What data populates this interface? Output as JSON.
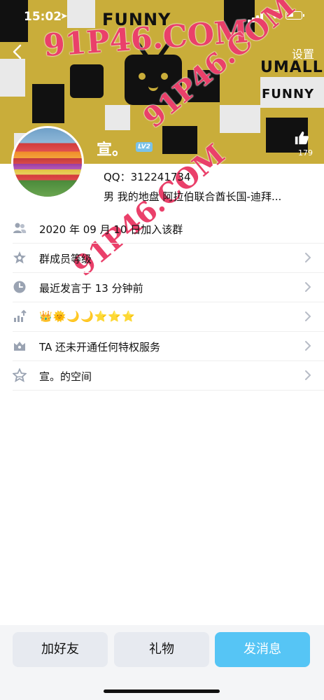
{
  "status_bar": {
    "time": "15:02"
  },
  "header": {
    "settings_label": "设置",
    "like_count": "179",
    "banner_words": [
      "FUNNY",
      "UMALL",
      "FUNNY"
    ]
  },
  "watermarks": [
    "91P46.COM",
    "91P46.COM",
    "91P46.COM"
  ],
  "profile": {
    "name": "宣。",
    "level_badge": "LV2",
    "qq_line": "QQ：312241734",
    "meta_line": "男   我的地盘   阿拉伯联合酋长国-迪拜..."
  },
  "rows": [
    {
      "icon": "members-icon",
      "text": "2020 年 09 月 10 日加入该群",
      "has_chevron": false
    },
    {
      "icon": "star-gear-icon",
      "text": "群成员等级",
      "has_chevron": true
    },
    {
      "icon": "clock-icon",
      "text": "最近发言于 13 分钟前",
      "has_chevron": true
    },
    {
      "icon": "rank-up-icon",
      "text": "👑🌞🌙🌙⭐⭐⭐",
      "has_chevron": true
    },
    {
      "icon": "crown-box-icon",
      "text": "TA 还未开通任何特权服务",
      "has_chevron": true
    },
    {
      "icon": "space-star-icon",
      "text": "宣。的空间",
      "has_chevron": true
    }
  ],
  "bottom_bar": {
    "add_friend": "加好友",
    "gift": "礼物",
    "message": "发消息"
  },
  "colors": {
    "banner": "#c9ad3a",
    "primary_button": "#56c5f5",
    "watermark": "#e61e50"
  }
}
